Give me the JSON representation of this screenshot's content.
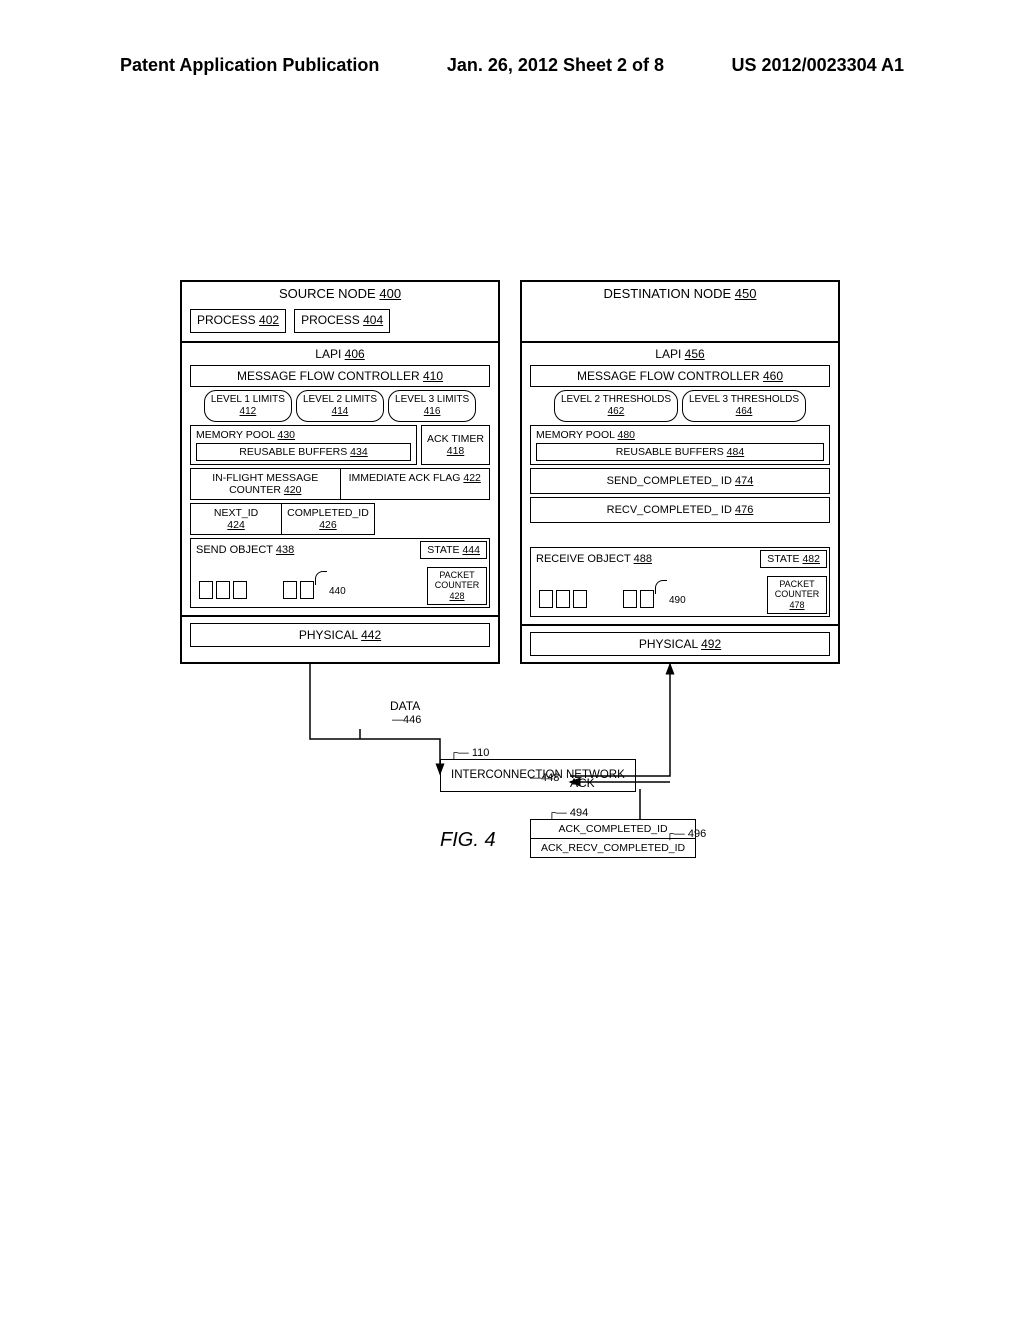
{
  "header": {
    "left": "Patent Application Publication",
    "center": "Jan. 26, 2012  Sheet 2 of 8",
    "right": "US 2012/0023304 A1"
  },
  "source": {
    "title": "SOURCE NODE",
    "title_ref": "400",
    "process1": "PROCESS",
    "process1_ref": "402",
    "process2": "PROCESS",
    "process2_ref": "404",
    "lapi": "LAPI",
    "lapi_ref": "406",
    "mfc": "MESSAGE FLOW CONTROLLER",
    "mfc_ref": "410",
    "limit1": "LEVEL 1 LIMITS",
    "limit1_ref": "412",
    "limit2": "LEVEL 2 LIMITS",
    "limit2_ref": "414",
    "limit3": "LEVEL 3 LIMITS",
    "limit3_ref": "416",
    "mempool": "MEMORY POOL",
    "mempool_ref": "430",
    "reusable": "REUSABLE BUFFERS",
    "reusable_ref": "434",
    "acktimer": "ACK TIMER",
    "acktimer_ref": "418",
    "inflight": "IN-FLIGHT MESSAGE COUNTER",
    "inflight_ref": "420",
    "immack": "IMMEDIATE ACK FLAG",
    "immack_ref": "422",
    "nextid": "NEXT_ID",
    "nextid_ref": "424",
    "compid": "COMPLETED_ID",
    "compid_ref": "426",
    "sendobj": "SEND OBJECT",
    "sendobj_ref": "438",
    "state": "STATE",
    "state_ref": "444",
    "pktcounter": "PACKET COUNTER",
    "pktcounter_ref": "428",
    "physical": "PHYSICAL",
    "physical_ref": "442",
    "ref440": "440"
  },
  "dest": {
    "title": "DESTINATION NODE",
    "title_ref": "450",
    "lapi": "LAPI",
    "lapi_ref": "456",
    "mfc": "MESSAGE FLOW CONTROLLER",
    "mfc_ref": "460",
    "thresh1": "LEVEL 2 THRESHOLDS",
    "thresh1_ref": "462",
    "thresh2": "LEVEL 3 THRESHOLDS",
    "thresh2_ref": "464",
    "mempool": "MEMORY POOL",
    "mempool_ref": "480",
    "reusable": "REUSABLE BUFFERS",
    "reusable_ref": "484",
    "sendcomp": "SEND_COMPLETED_ ID",
    "sendcomp_ref": "474",
    "recvcomp": "RECV_COMPLETED_ ID",
    "recvcomp_ref": "476",
    "recvobj": "RECEIVE OBJECT",
    "recvobj_ref": "488",
    "state": "STATE",
    "state_ref": "482",
    "pktcounter": "PACKET COUNTER",
    "pktcounter_ref": "478",
    "physical": "PHYSICAL",
    "physical_ref": "492",
    "ref490": "490"
  },
  "bottom": {
    "data": "DATA",
    "data_ref": "446",
    "interconn": "INTERCONNECTION NETWORK",
    "interconn_ref": "110",
    "ack": "ACK",
    "ack_ref": "448",
    "ackcomp": "ACK_COMPLETED_ID",
    "ackcomp_ref": "494",
    "ackrecv": "ACK_RECV_COMPLETED_ID",
    "ackrecv_ref": "496",
    "fig": "FIG. 4"
  }
}
